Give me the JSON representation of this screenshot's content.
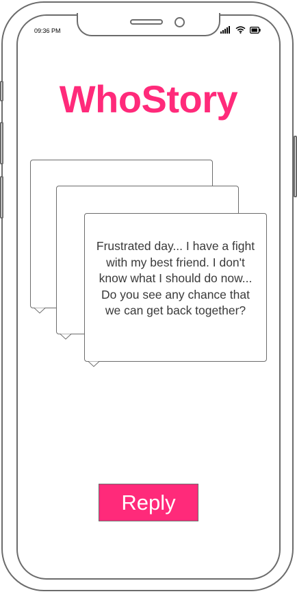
{
  "status_bar": {
    "time": "09:36 PM",
    "icons": [
      "signal-icon",
      "wifi-icon",
      "battery-icon"
    ]
  },
  "app": {
    "title": "WhoStory",
    "accent_color": "#ff2a7a"
  },
  "story_stack": {
    "visible_story": "Frustrated day... I have a fight with my best friend. I don't know what I should do now... Do you see any chance that we can get back together?"
  },
  "actions": {
    "reply_label": "Reply"
  }
}
